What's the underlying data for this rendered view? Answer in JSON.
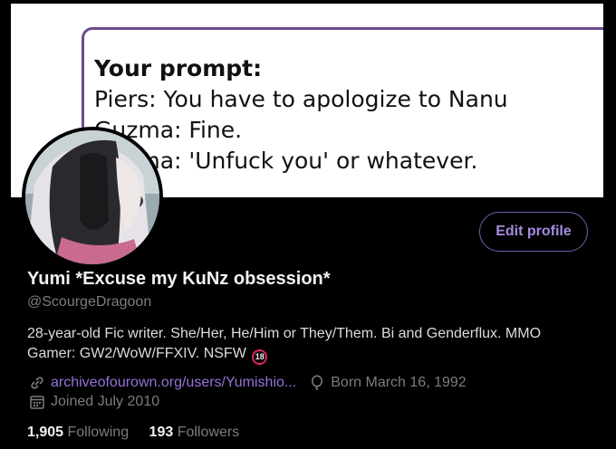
{
  "banner": {
    "prompt_title": "Your prompt:",
    "lines": [
      "Piers: You have to apologize to Nanu",
      "Guzma: Fine.",
      "Guzma: 'Unfuck you' or whatever."
    ]
  },
  "profile": {
    "edit_label": "Edit profile",
    "name": "Yumi *Excuse my KuNz obsession*",
    "handle": "@ScourgeDragoon",
    "bio": "28-year-old Fic writer. She/Her, He/Him or They/Them. Bi and Genderflux. MMO Gamer: GW2/WoW/FFXIV. NSFW",
    "nsfw_badge": "18",
    "link": "archiveofourown.org/users/Yumishio...",
    "birthday": "Born March 16, 1992",
    "joined": "Joined July 2010",
    "following_count": "1,905",
    "following_label": "Following",
    "followers_count": "193",
    "followers_label": "Followers"
  },
  "colors": {
    "background": "#000000",
    "accent": "#9572d9",
    "muted_text": "#7c7c7c",
    "badge": "#e0245e"
  },
  "icons": [
    "link-icon",
    "balloon-icon",
    "calendar-icon"
  ]
}
